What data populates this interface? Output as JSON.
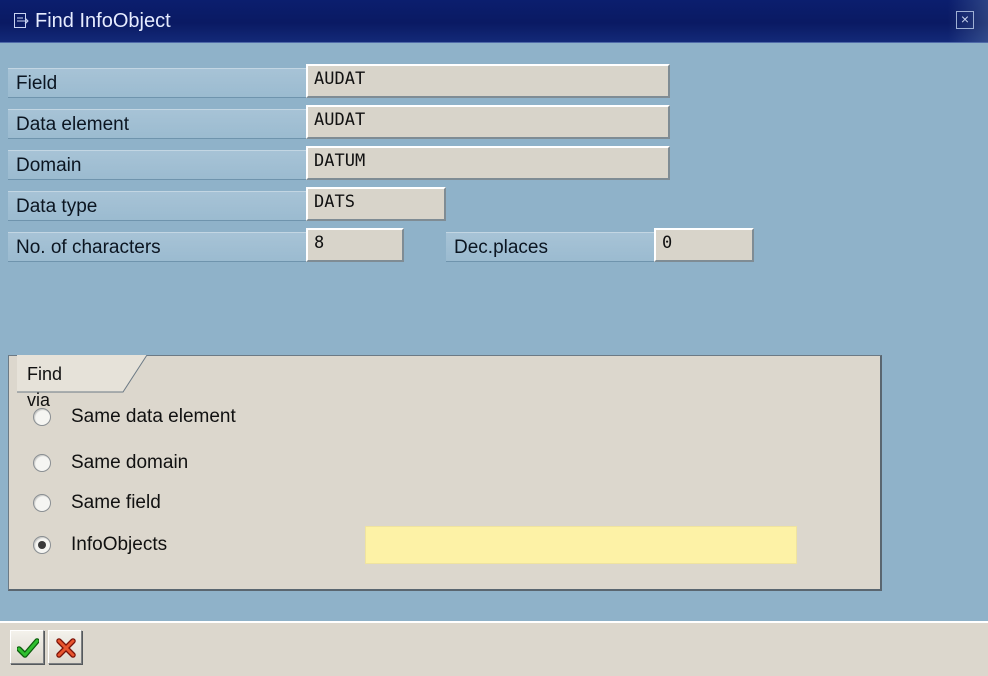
{
  "window": {
    "title": "Find InfoObject",
    "close_glyph": "×"
  },
  "fields": {
    "field": {
      "label": "Field",
      "value": "AUDAT"
    },
    "data_element": {
      "label": "Data element",
      "value": "AUDAT"
    },
    "domain": {
      "label": "Domain",
      "value": "DATUM"
    },
    "data_type": {
      "label": "Data type",
      "value": "DATS"
    },
    "num_chars": {
      "label": "No. of characters",
      "value": "8"
    },
    "dec_places": {
      "label": "Dec.places",
      "value": "0"
    }
  },
  "find_via": {
    "title": "Find via",
    "options": [
      {
        "label": "Same data element",
        "checked": false
      },
      {
        "label": "Same domain",
        "checked": false
      },
      {
        "label": "Same field",
        "checked": false
      },
      {
        "label": "InfoObjects",
        "checked": true
      }
    ],
    "infoobjects_value": ""
  },
  "toolbar": {
    "confirm_icon": "checkmark-icon",
    "cancel_icon": "cancel-x-icon"
  },
  "colors": {
    "title_bar": "#0a1a63",
    "background": "#8fb2c9",
    "panel": "#dcd7cd",
    "field_bg": "#d8d4ca",
    "required_input": "#fdf2a6",
    "confirm_green": "#1d9a1d",
    "cancel_red": "#d02a1a"
  }
}
